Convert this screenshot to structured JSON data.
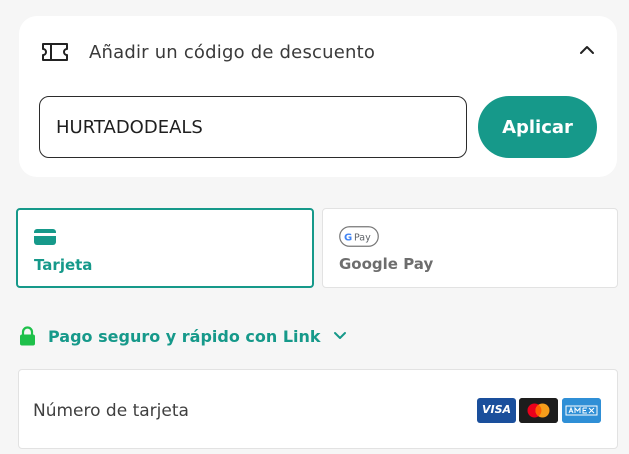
{
  "discount": {
    "title": "Añadir un código de descuento",
    "code_value": "HURTADODEALS",
    "apply_label": "Aplicar"
  },
  "payment_methods": [
    {
      "label": "Tarjeta",
      "icon": "credit-card-icon",
      "selected": true
    },
    {
      "label": "Google Pay",
      "icon": "google-pay-icon",
      "selected": false
    }
  ],
  "gpay_badge": "Pay",
  "link": {
    "label": "Pago seguro y rápido con Link",
    "icon": "lock-icon"
  },
  "card_number": {
    "label": "Número de tarjeta",
    "brands": [
      {
        "name": "visa-logo",
        "text": "VISA"
      },
      {
        "name": "mastercard-logo"
      },
      {
        "name": "amex-logo"
      }
    ]
  },
  "colors": {
    "accent": "#16998a",
    "background": "#f6f6f6",
    "text": "#3a3a3a"
  }
}
